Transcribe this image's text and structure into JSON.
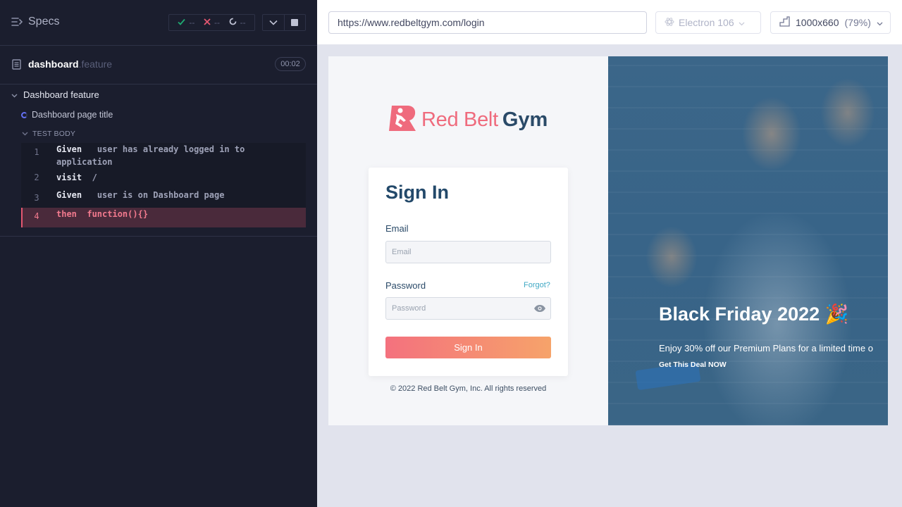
{
  "reporter": {
    "specs_label": "Specs",
    "stats": {
      "passed": "--",
      "failed": "--",
      "pending": "--"
    },
    "spec": {
      "name": "dashboard",
      "ext": ".feature",
      "duration": "00:02"
    },
    "suite_title": "Dashboard feature",
    "test_title": "Dashboard page title",
    "test_body_label": "TEST BODY",
    "commands": [
      {
        "num": "1",
        "keyword": "Given",
        "message_line1": "user has already logged in to",
        "message_line2": "application"
      },
      {
        "num": "2",
        "keyword": "visit",
        "message": "/"
      },
      {
        "num": "3",
        "keyword": "Given",
        "message": "user is on Dashboard page"
      },
      {
        "num": "4",
        "keyword": "then",
        "message": "function(){}"
      }
    ]
  },
  "toolbar": {
    "url": "https://www.redbeltgym.com/login",
    "browser": "Electron 106",
    "viewport_size": "1000x660",
    "viewport_zoom": "(79%)"
  },
  "app": {
    "logo": {
      "part1": "Red Belt",
      "part2": "Gym"
    },
    "signin": {
      "title": "Sign In",
      "email_label": "Email",
      "email_placeholder": "Email",
      "password_label": "Password",
      "forgot_label": "Forgot?",
      "password_placeholder": "Password",
      "submit_label": "Sign In"
    },
    "copyright": "© 2022 Red Belt Gym, Inc. All rights reserved",
    "promo": {
      "title": "Black Friday 2022 🎉",
      "subtitle": "Enjoy 30% off our Premium Plans for a limited time o",
      "cta": "Get This Deal NOW"
    }
  },
  "colors": {
    "reporter_bg": "#1b1e2e",
    "failed_row_bg": "#4a2a3b",
    "brand_red": "#ef6b7d",
    "brand_navy": "#23496a",
    "promo_blue": "#386488"
  }
}
